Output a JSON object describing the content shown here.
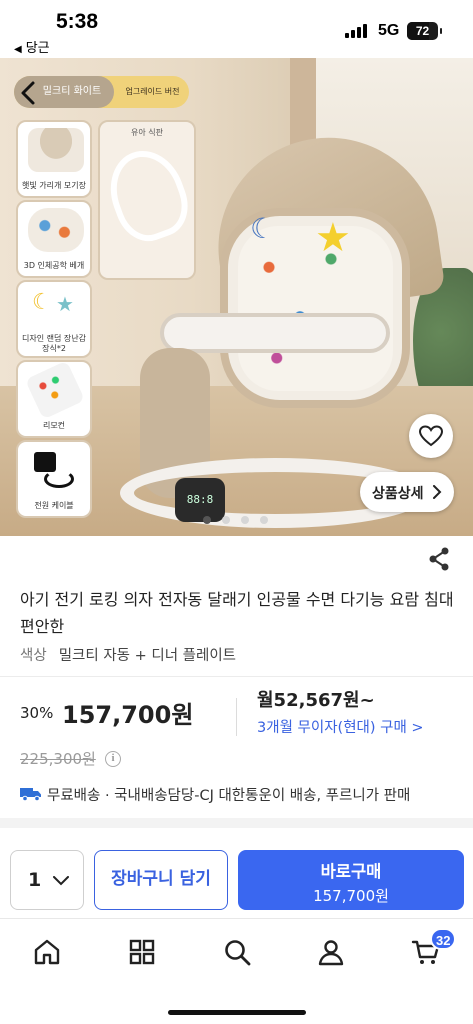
{
  "status_bar": {
    "time": "5:38",
    "back_app": "당근",
    "network": "5G",
    "battery": "72",
    "battery_level_percent": 72
  },
  "gallery": {
    "variant_selected": "밀크티 화이트",
    "variant_upgrade": "업그레이드 버전",
    "features": [
      {
        "icon": "canopy-icon",
        "label": "햇빛 가리개 모기장"
      },
      {
        "icon": "pillow-icon",
        "label": "3D 인체공학 베개"
      },
      {
        "icon": "toy-icon",
        "label": "디자인 랜덤 장난감 장식*2"
      },
      {
        "icon": "remote-icon",
        "label": "리모컨"
      },
      {
        "icon": "power-cable-icon",
        "label": "전원 케이블"
      }
    ],
    "inset_caption": "유아 식판",
    "panel_display": "88:8",
    "detail_button": "상품상세",
    "current_slide": 1,
    "slide_count": 4
  },
  "product": {
    "title": "아기 전기 로킹 의자 전자동 달래기 인공물 수면 다기능 요람 침대 편안한",
    "option_label": "색상",
    "option_value": "밀크티 자동 + 디너 플레이트",
    "discount": "30%",
    "price": "157,700원",
    "original_price": "225,300원",
    "monthly_price": "월52,567원~",
    "installment": "3개월 무이자(현대) 구매 >",
    "shipping": "무료배송 · 국내배송담당-CJ 대한통운이 배송, 푸르니가 판매"
  },
  "purchase_bar": {
    "quantity": "1",
    "cart_button": "장바구니 담기",
    "buy_button": "바로구매",
    "buy_price": "157,700원"
  },
  "bottom_nav": {
    "items": [
      "home-icon",
      "category-grid-icon",
      "search-icon",
      "profile-icon",
      "cart-icon"
    ],
    "cart_badge": "32"
  },
  "colors": {
    "accent": "#3a67f0",
    "link": "#3a62e0"
  }
}
